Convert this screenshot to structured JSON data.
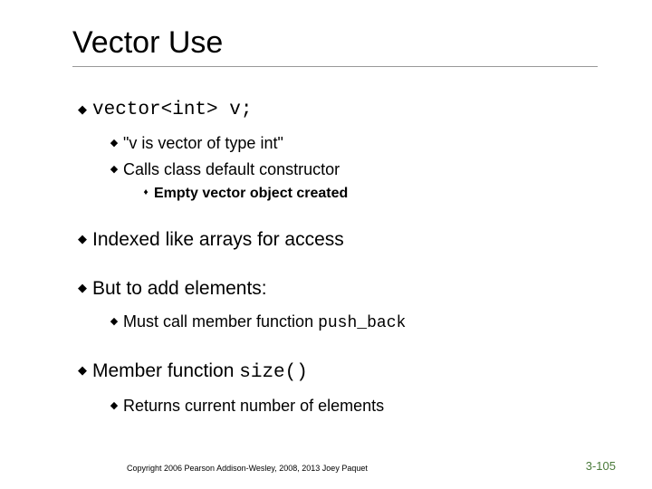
{
  "title": "Vector Use",
  "b1_code": "vector<int> v;",
  "b1_s1": "\"v is vector of type int\"",
  "b1_s2": "Calls class default constructor",
  "b1_s2_s1": "Empty vector object created",
  "b2": "Indexed like arrays for access",
  "b3": "But to add elements:",
  "b3_s1_pre": "Must call member function ",
  "b3_s1_code": "push_back",
  "b4_pre": "Member function ",
  "b4_code": "size()",
  "b4_s1": "Returns current number of elements",
  "copyright": "Copyright 2006 Pearson Addison-Wesley, 2008, 2013 Joey Paquet",
  "pagenum": "3-105",
  "markers": {
    "diamond": "◆",
    "square": "♦"
  }
}
